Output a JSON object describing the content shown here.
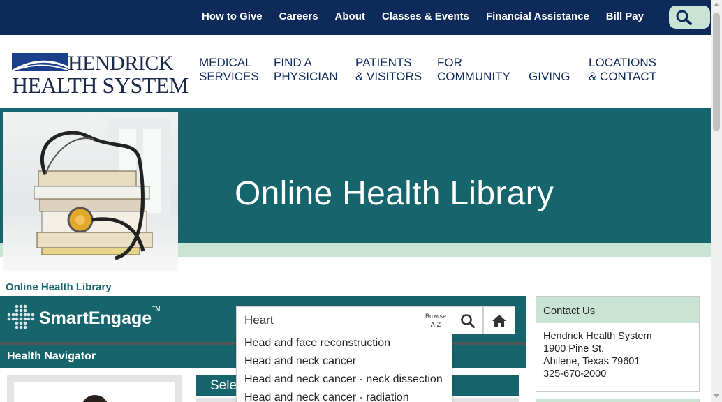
{
  "topbar": {
    "links": [
      "How to Give",
      "Careers",
      "About",
      "Classes & Events",
      "Financial Assistance",
      "Bill Pay"
    ],
    "search_icon": "search-icon"
  },
  "logo": {
    "line1": "HENDRICK",
    "line2": "HEALTH SYSTEM"
  },
  "nav": {
    "items": [
      {
        "line1": "MEDICAL",
        "line2": "SERVICES"
      },
      {
        "line1": "FIND A",
        "line2": "PHYSICIAN"
      },
      {
        "line1": "PATIENTS",
        "line2": "& VISITORS"
      },
      {
        "line1": "FOR",
        "line2": "COMMUNITY"
      },
      {
        "line1": "GIVING",
        "line2": ""
      },
      {
        "line1": "LOCATIONS",
        "line2": "& CONTACT"
      }
    ]
  },
  "hero": {
    "title": "Online Health Library",
    "image": "stethoscope-on-books"
  },
  "breadcrumb": "Online Health Library",
  "smartengage": {
    "brand": "SmartEngage",
    "tm": "TM",
    "search_value": "Heart",
    "browse_line1": "Browse",
    "browse_line2": "A-Z",
    "search_icon": "search-icon",
    "home_icon": "home-icon"
  },
  "autocomplete": {
    "items": [
      "Head and face reconstruction",
      "Head and neck cancer",
      "Head and neck cancer - neck dissection",
      "Head and neck cancer - radiation"
    ]
  },
  "health_navigator": {
    "title": "Health Navigator",
    "select_label": "Sele"
  },
  "contact": {
    "header": "Contact Us",
    "name": "Hendrick Health System",
    "street": "1900 Pine St.",
    "city": "Abilene, Texas 79601",
    "phone": "325-670-2000"
  },
  "colors": {
    "navy": "#0d2a5a",
    "teal": "#16656d",
    "mint": "#c9e3d4"
  }
}
